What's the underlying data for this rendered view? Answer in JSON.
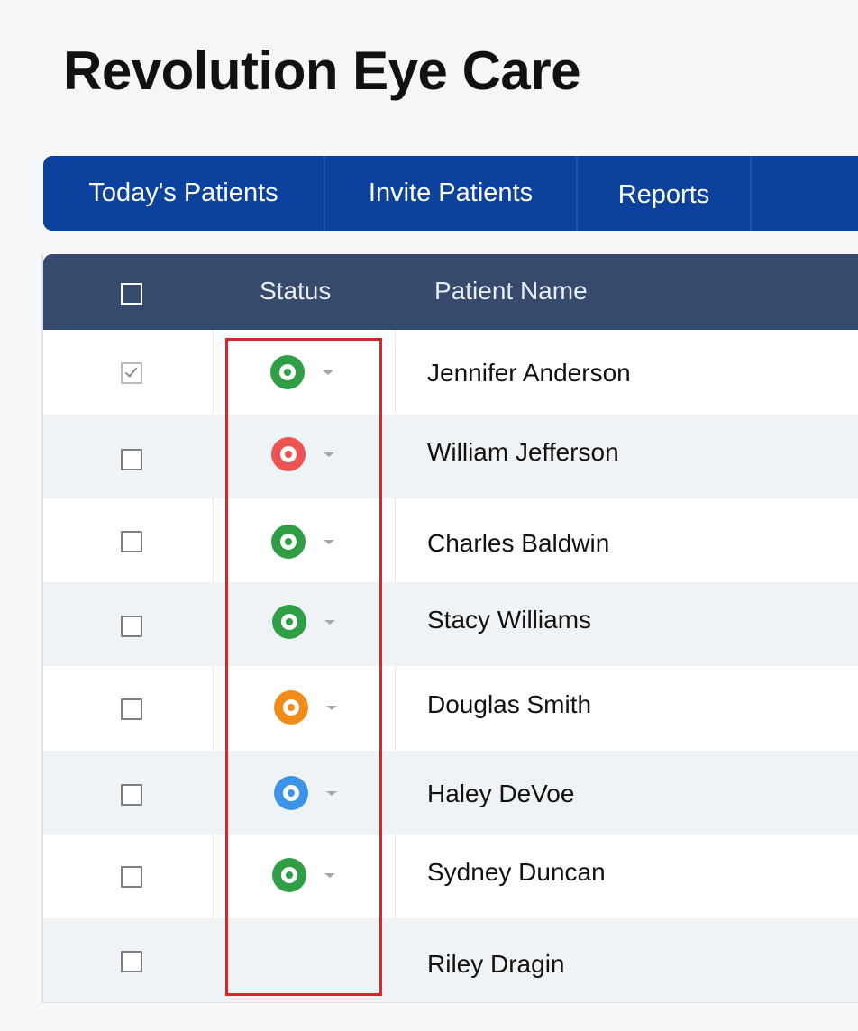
{
  "app": {
    "title": "Revolution Eye Care"
  },
  "nav": {
    "tabs": [
      {
        "label": "Today's Patients"
      },
      {
        "label": "Invite Patients"
      },
      {
        "label": "Reports"
      }
    ]
  },
  "table": {
    "headers": {
      "status": "Status",
      "patient_name": "Patient Name"
    },
    "rows": [
      {
        "name": "Jennifer Anderson",
        "checked": true,
        "status": "green"
      },
      {
        "name": "William Jefferson",
        "checked": false,
        "status": "red"
      },
      {
        "name": "Charles Baldwin",
        "checked": false,
        "status": "green"
      },
      {
        "name": "Stacy Williams",
        "checked": false,
        "status": "green"
      },
      {
        "name": "Douglas Smith",
        "checked": false,
        "status": "orange"
      },
      {
        "name": "Haley DeVoe",
        "checked": false,
        "status": "blue"
      },
      {
        "name": "Sydney Duncan",
        "checked": false,
        "status": "green"
      },
      {
        "name": "Riley Dragin",
        "checked": false,
        "status": "none"
      }
    ]
  },
  "colors": {
    "nav_bg": "#0c419e",
    "header_bg": "#354a6c",
    "highlight": "#d9262c",
    "status_green": "#2f9e44",
    "status_red": "#ef5252",
    "status_orange": "#f08c1a",
    "status_blue": "#3d94e6"
  }
}
